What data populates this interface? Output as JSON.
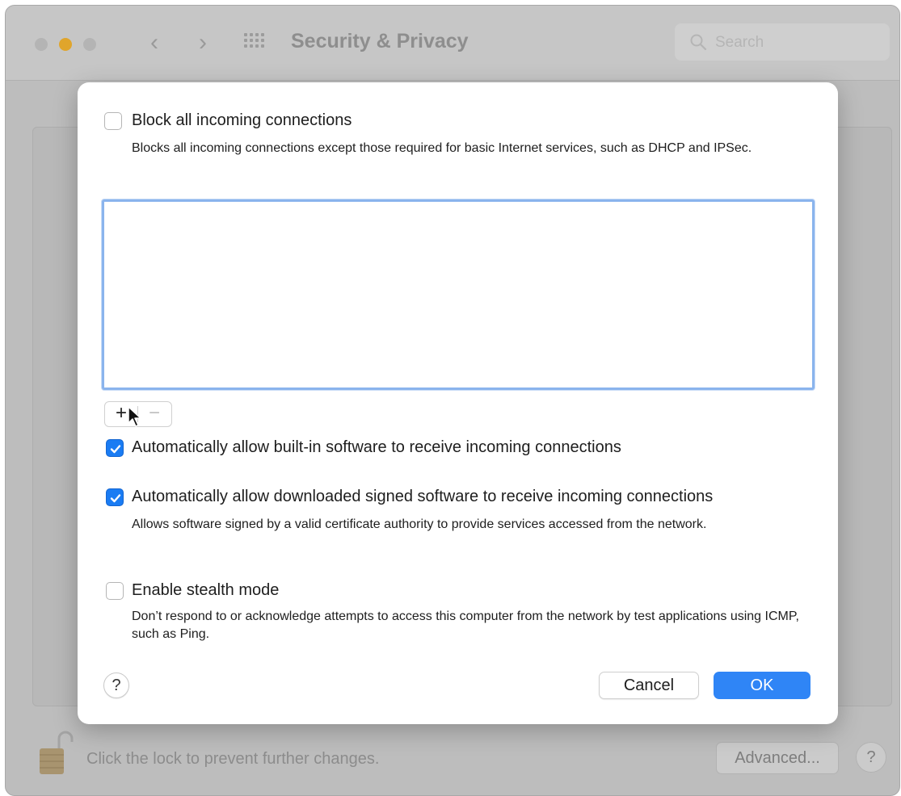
{
  "window": {
    "title": "Security & Privacy",
    "search_placeholder": "Search",
    "nav_back": "‹",
    "nav_forward": "›"
  },
  "footer": {
    "lock_text": "Click the lock to prevent further changes.",
    "advanced_label": "Advanced...",
    "help_label": "?"
  },
  "sheet": {
    "block_all": {
      "label": "Block all incoming connections",
      "checked": false,
      "description": "Blocks all incoming connections except those required for basic Internet services, such as DHCP and IPSec."
    },
    "app_list": {
      "items": [],
      "add_label": "+",
      "remove_label": "−"
    },
    "auto_builtin": {
      "label": "Automatically allow built-in software to receive incoming connections",
      "checked": true
    },
    "auto_signed": {
      "label": "Automatically allow downloaded signed software to receive incoming connections",
      "checked": true,
      "description": "Allows software signed by a valid certificate authority to provide services accessed from the network."
    },
    "stealth": {
      "label": "Enable stealth mode",
      "checked": false,
      "description": "Don’t respond to or acknowledge attempts to access this computer from the network by test applications using ICMP, such as Ping."
    },
    "help_label": "?",
    "cancel_label": "Cancel",
    "ok_label": "OK"
  },
  "colors": {
    "accent": "#2f85f6",
    "checkbox_on": "#1a7cf3",
    "list_focus_ring": "#8ab4ed",
    "minimize_button": "#e0a52c"
  },
  "icons": [
    "search-icon",
    "grid-icon",
    "lock-icon",
    "checkmark-icon",
    "cursor-icon"
  ]
}
